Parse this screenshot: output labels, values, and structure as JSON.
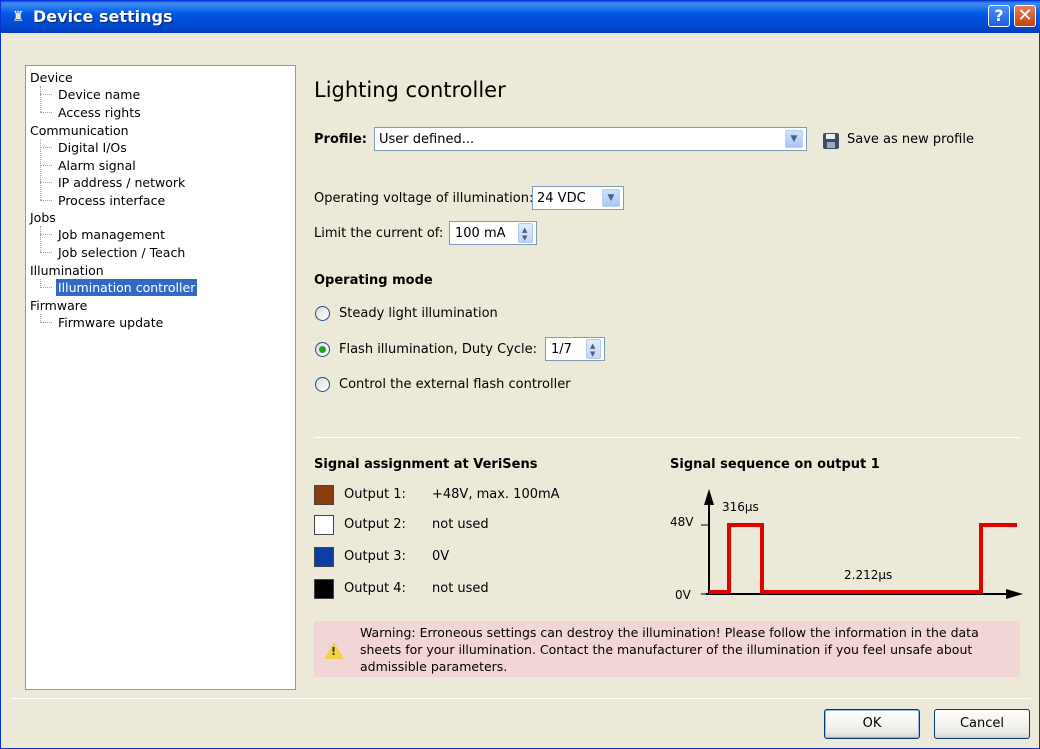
{
  "window": {
    "title": "Device settings"
  },
  "tree": {
    "groups": [
      {
        "label": "Device",
        "children": [
          "Device name",
          "Access rights"
        ]
      },
      {
        "label": "Communication",
        "children": [
          "Digital I/Os",
          "Alarm signal",
          "IP address / network",
          "Process interface"
        ]
      },
      {
        "label": "Jobs",
        "children": [
          "Job management",
          "Job selection / Teach"
        ]
      },
      {
        "label": "Illumination",
        "children": [
          "Illumination controller"
        ]
      },
      {
        "label": "Firmware",
        "children": [
          "Firmware update"
        ]
      }
    ],
    "selected": "Illumination controller"
  },
  "main": {
    "title": "Lighting controller",
    "profile_label": "Profile:",
    "profile_value": "User defined...",
    "save_profile_label": "Save as new profile",
    "voltage_label": "Operating voltage of illumination:",
    "voltage_value": "24 VDC",
    "current_label": "Limit the current of:",
    "current_value": "100 mA",
    "operating_mode_heading": "Operating mode",
    "modes": [
      {
        "label": "Steady light illumination",
        "checked": false
      },
      {
        "label": "Flash illumination, Duty Cycle:",
        "checked": true
      },
      {
        "label": "Control the external flash controller",
        "checked": false
      }
    ],
    "duty_cycle_value": "1/7"
  },
  "signal_assignment": {
    "heading": "Signal assignment at VeriSens",
    "outputs": [
      {
        "label": "Output 1:",
        "value": "+48V, max. 100mA",
        "color": "#8b3d0a"
      },
      {
        "label": "Output 2:",
        "value": "not used",
        "color": "#ffffff"
      },
      {
        "label": "Output 3:",
        "value": "0V",
        "color": "#0d3ea6"
      },
      {
        "label": "Output 4:",
        "value": "not used",
        "color": "#000000"
      }
    ]
  },
  "signal_sequence": {
    "heading": "Signal sequence on output 1",
    "high_label": "48V",
    "low_label": "0V",
    "pulse_label": "316µs",
    "gap_label": "2.212µs"
  },
  "warning": {
    "text": "Warning: Erroneous settings can destroy the illumination! Please follow the information in the data sheets for your illumination. Contact the manufacturer of the illumination if you feel unsafe about admissible parameters."
  },
  "buttons": {
    "ok": "OK",
    "cancel": "Cancel"
  },
  "colors": {
    "title_bar": "#0054e3",
    "selection": "#316ac5",
    "signal_line": "#e00000",
    "warning_bg": "#f2d6d6"
  }
}
